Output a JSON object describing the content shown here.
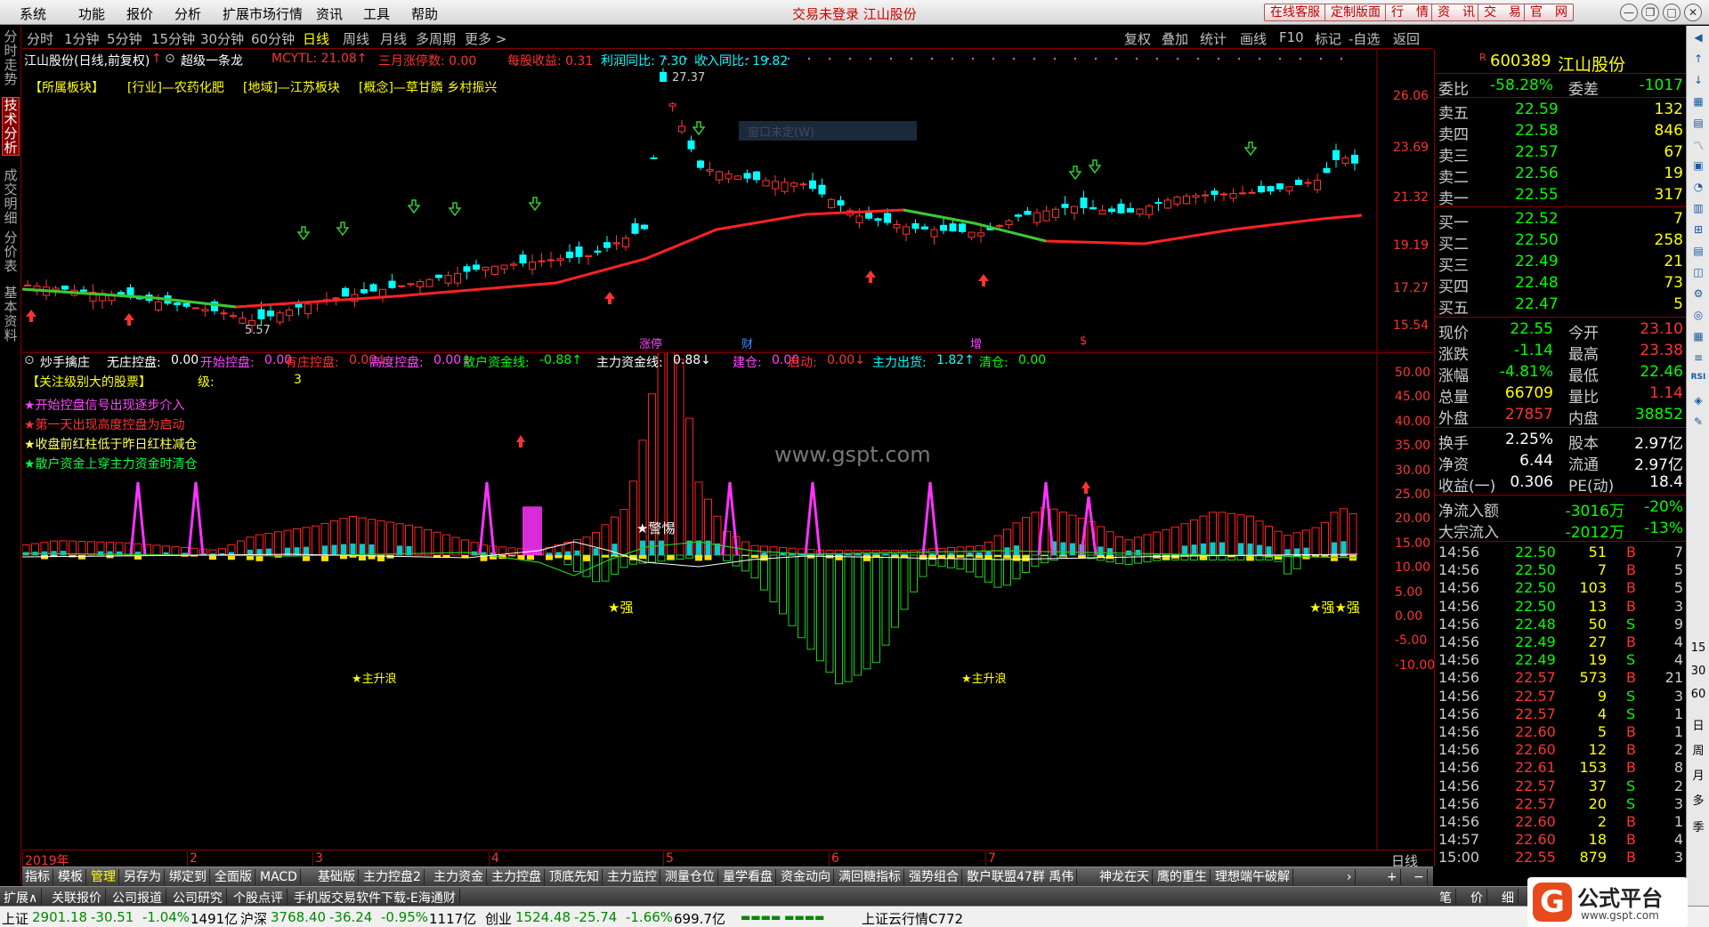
{
  "menu": [
    "系统",
    "功能",
    "报价",
    "分析",
    "扩展市场行情",
    "资讯",
    "工具",
    "帮助"
  ],
  "login_status": "交易未登录  江山股份",
  "top_buttons": [
    "在线客服",
    "定制版面",
    "行　情",
    "资　讯",
    "交　易",
    "官　网"
  ],
  "left_tabs": [
    "分时走势",
    "技术分析",
    "成交明细",
    "分价表",
    "基本资料"
  ],
  "periods": [
    "分时",
    "1分钟",
    "5分钟",
    "15分钟",
    "30分钟",
    "60分钟",
    "日线",
    "周线",
    "月线",
    "多周期",
    "更多 >"
  ],
  "active_period": "日线",
  "tools": [
    "复权",
    "叠加",
    "统计",
    "画线",
    "F10",
    "标记",
    "-自选",
    "返回"
  ],
  "chart_header": {
    "name": "江山股份(日线,前复权)",
    "indicator": "超级一条龙",
    "mcytl": "MCYTL: 21.08↑",
    "sanyue": "三月涨停数: 0.00",
    "mgsy": "每股收益: 0.31",
    "lrtb": "利润同比: 7.30",
    "srtb": "收入同比: 19.82"
  },
  "sector_tags": [
    "【所属板块】",
    "[行业]—农药化肥",
    "[地域]—江苏板块",
    "[概念]—草甘膦  乡村振兴"
  ],
  "price_axis": [
    "26.06",
    "23.69",
    "21.32",
    "19.19",
    "17.27",
    "15.54"
  ],
  "price_markers": {
    "high": "27.37",
    "low": "5.57",
    "tooltip": "窗口未定(W)"
  },
  "event_labels": [
    "涨停",
    "财",
    "增",
    "$"
  ],
  "sub_header": {
    "name": "炒手擒庄",
    "items": [
      {
        "label": "无庄控盘:",
        "value": "0.00",
        "color": "#ffffff"
      },
      {
        "label": "开始控盘:",
        "value": "0.00",
        "color": "#ff44ff"
      },
      {
        "label": "有庄控盘:",
        "value": "0.00↓",
        "color": "#ff3333"
      },
      {
        "label": "高度控盘:",
        "value": "0.00↓",
        "color": "#ff44ff"
      },
      {
        "label": "散户资金线:",
        "value": "-0.88↑",
        "color": "#00ff00"
      },
      {
        "label": "主力资金线:",
        "value": "0.88↓",
        "color": "#ffffff"
      },
      {
        "label": "建仓:",
        "value": "0.00",
        "color": "#ff44ff"
      },
      {
        "label": "启动:",
        "value": "0.00↓",
        "color": "#ff3333"
      },
      {
        "label": "主力出货:",
        "value": "1.82↑",
        "color": "#00ffff"
      },
      {
        "label": "清仓:",
        "value": "0.00",
        "color": "#00ff00"
      }
    ]
  },
  "legend": {
    "title": "【关注级别大的股票】",
    "level_label": "级:",
    "level_value": "3",
    "lines": [
      {
        "text": "★开始控盘信号出现逐步介入",
        "color": "#ff44ff"
      },
      {
        "text": "★第一天出现高度控盘为启动",
        "color": "#ff3333"
      },
      {
        "text": "★收盘前红柱低于昨日红柱减仓",
        "color": "#ffff66"
      },
      {
        "text": "★散户资金上穿主力资金时清仓",
        "color": "#00ff44"
      }
    ]
  },
  "sub_annotations": {
    "warn": "★警惕",
    "strong1": "★强",
    "strong2": "★强★强",
    "rise1": "★主升浪",
    "rise2": "★主升浪"
  },
  "watermark": "www.gspt.com",
  "sub_axis": [
    "50.00",
    "45.00",
    "40.00",
    "35.00",
    "30.00",
    "25.00",
    "20.00",
    "15.00",
    "10.00",
    "5.00",
    "0.00",
    "-5.00",
    "-10.00"
  ],
  "x_axis": [
    "2019年",
    "2",
    "3",
    "4",
    "5",
    "6",
    "7"
  ],
  "x_axis_period": "日线",
  "quote": {
    "code": "600389",
    "name": "江山股份",
    "weibi_label": "委比",
    "weibi_value": "-58.28%",
    "weicha_label": "委差",
    "weicha_value": "-1017",
    "asks": [
      {
        "label": "卖五",
        "price": "22.59",
        "vol": "132"
      },
      {
        "label": "卖四",
        "price": "22.58",
        "vol": "846"
      },
      {
        "label": "卖三",
        "price": "22.57",
        "vol": "67"
      },
      {
        "label": "卖二",
        "price": "22.56",
        "vol": "19"
      },
      {
        "label": "卖一",
        "price": "22.55",
        "vol": "317"
      }
    ],
    "bids": [
      {
        "label": "买一",
        "price": "22.52",
        "vol": "7"
      },
      {
        "label": "买二",
        "price": "22.50",
        "vol": "258"
      },
      {
        "label": "买三",
        "price": "22.49",
        "vol": "21"
      },
      {
        "label": "买四",
        "price": "22.48",
        "vol": "73"
      },
      {
        "label": "买五",
        "price": "22.47",
        "vol": "5"
      }
    ],
    "stats": [
      {
        "l1": "现价",
        "v1": "22.55",
        "c1": "#00ff00",
        "l2": "今开",
        "v2": "23.10",
        "c2": "#ff3333"
      },
      {
        "l1": "涨跌",
        "v1": "-1.14",
        "c1": "#00ff00",
        "l2": "最高",
        "v2": "23.38",
        "c2": "#ff3333"
      },
      {
        "l1": "涨幅",
        "v1": "-4.81%",
        "c1": "#00ff00",
        "l2": "最低",
        "v2": "22.46",
        "c2": "#00ff00"
      },
      {
        "l1": "总量",
        "v1": "66709",
        "c1": "#ffff00",
        "l2": "量比",
        "v2": "1.14",
        "c2": "#ff3333"
      },
      {
        "l1": "外盘",
        "v1": "27857",
        "c1": "#ff3333",
        "l2": "内盘",
        "v2": "38852",
        "c2": "#00ff00"
      }
    ],
    "fundamentals": [
      {
        "l1": "换手",
        "v1": "2.25%",
        "l2": "股本",
        "v2": "2.97亿"
      },
      {
        "l1": "净资",
        "v1": "6.44",
        "l2": "流通",
        "v2": "2.97亿"
      },
      {
        "l1": "收益(一)",
        "v1": "0.306",
        "l2": "PE(动)",
        "v2": "18.4"
      }
    ],
    "flows": [
      {
        "label": "净流入额",
        "value": "-3016万",
        "pct": "-20%"
      },
      {
        "label": "大宗流入",
        "value": "-2012万",
        "pct": "-13%"
      }
    ],
    "ticks": [
      [
        "14:56",
        "22.50",
        "51",
        "B",
        "7"
      ],
      [
        "14:56",
        "22.50",
        "7",
        "B",
        "5"
      ],
      [
        "14:56",
        "22.50",
        "103",
        "B",
        "5"
      ],
      [
        "14:56",
        "22.50",
        "13",
        "B",
        "3"
      ],
      [
        "14:56",
        "22.48",
        "50",
        "S",
        "9"
      ],
      [
        "14:56",
        "22.49",
        "27",
        "B",
        "4"
      ],
      [
        "14:56",
        "22.49",
        "19",
        "S",
        "4"
      ],
      [
        "14:56",
        "22.57",
        "573",
        "B",
        "21"
      ],
      [
        "14:56",
        "22.57",
        "9",
        "S",
        "3"
      ],
      [
        "14:56",
        "22.57",
        "4",
        "S",
        "1"
      ],
      [
        "14:56",
        "22.60",
        "5",
        "B",
        "1"
      ],
      [
        "14:56",
        "22.60",
        "12",
        "B",
        "2"
      ],
      [
        "14:56",
        "22.61",
        "153",
        "B",
        "8"
      ],
      [
        "14:56",
        "22.57",
        "37",
        "S",
        "2"
      ],
      [
        "14:56",
        "22.57",
        "20",
        "S",
        "3"
      ],
      [
        "14:56",
        "22.60",
        "2",
        "B",
        "1"
      ],
      [
        "14:57",
        "22.60",
        "18",
        "B",
        "4"
      ],
      [
        "15:00",
        "22.55",
        "879",
        "B",
        "3"
      ]
    ]
  },
  "bottom_tabs": [
    "指标",
    "模板",
    "管理",
    "另存为",
    "绑定到",
    "全面版",
    "MACD",
    "基础版",
    "主力控盘2",
    "主力资金",
    "主力控盘",
    "顶底先知",
    "主力监控",
    "测量仓位",
    "量学看盘",
    "资金动向",
    "满回糖指标",
    "强势组合",
    "散户联盟47群 禹伟",
    "神龙在天",
    "鹰的重生",
    "理想端午破解"
  ],
  "active_bottom_tab": "管理",
  "info_tabs": [
    "扩展∧",
    "关联报价",
    "公司报道",
    "公司研究",
    "个股点评",
    "手机版交易软件下载-E海通财"
  ],
  "right_bottom_tabs": [
    "笔",
    "价",
    "细"
  ],
  "status": [
    {
      "name": "上证",
      "v": "2901.18",
      "c": "-30.51",
      "p": "-1.04%",
      "a": "1491亿"
    },
    {
      "name": "沪深",
      "v": "3768.40",
      "c": "-36.24",
      "p": "-0.95%",
      "a": "1117亿"
    },
    {
      "name": "创业",
      "v": "1524.48",
      "c": "-25.74",
      "p": "-1.66%",
      "a": "699.7亿"
    }
  ],
  "status_extra": "上证云行情C772",
  "logo_text": "公式平台",
  "logo_url": "www.gspt.com",
  "right_toolbar_labels": [
    "RSI",
    "15",
    "30",
    "60",
    "日",
    "周",
    "月",
    "多",
    "季"
  ]
}
